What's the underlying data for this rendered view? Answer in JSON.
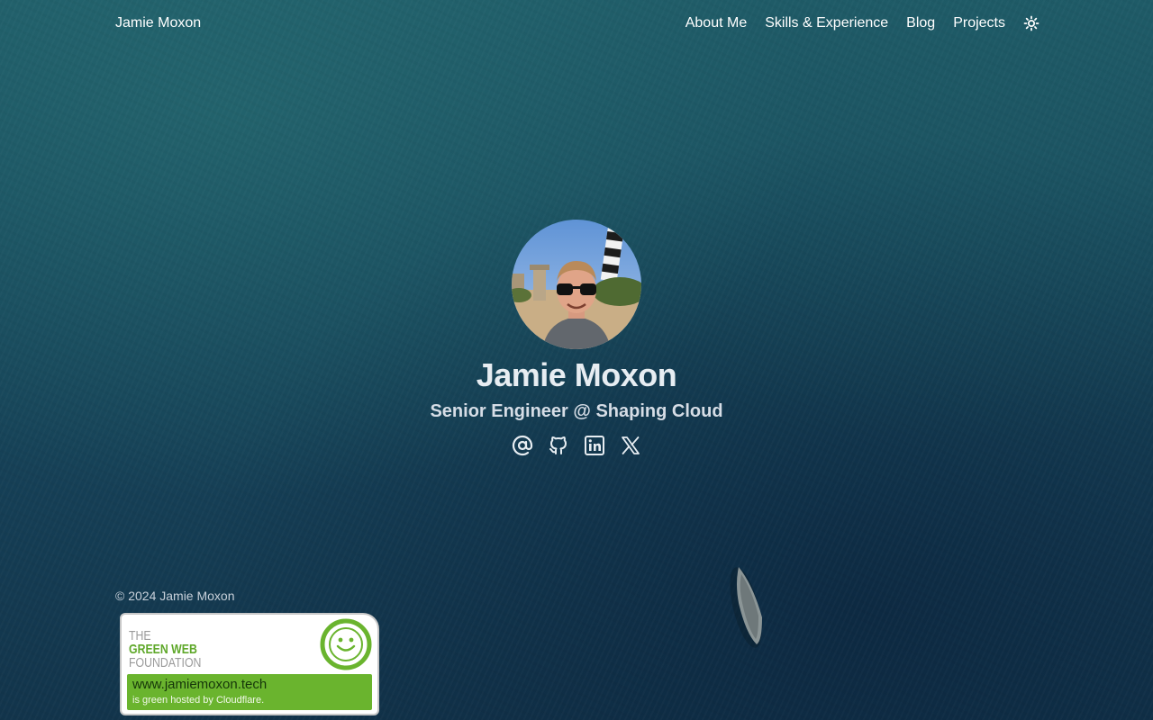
{
  "header": {
    "brand": "Jamie Moxon",
    "nav": [
      {
        "label": "About Me"
      },
      {
        "label": "Skills & Experience"
      },
      {
        "label": "Blog"
      },
      {
        "label": "Projects"
      }
    ],
    "theme_toggle_icon": "sun-icon"
  },
  "hero": {
    "avatar_icon": "profile-photo",
    "name": "Jamie Moxon",
    "subtitle": "Senior Engineer @ Shaping Cloud",
    "social": [
      {
        "icon": "at-sign-icon"
      },
      {
        "icon": "github-icon"
      },
      {
        "icon": "linkedin-icon"
      },
      {
        "icon": "x-twitter-icon"
      }
    ]
  },
  "footer": {
    "copyright": "© 2024 Jamie Moxon",
    "badge": {
      "logo_line1": "THE",
      "logo_line2": "GREEN WEB",
      "logo_line3": "FOUNDATION",
      "url": "www.jamiemoxon.tech",
      "note": "is green hosted by Cloudflare."
    }
  },
  "colors": {
    "background": "#194c5e",
    "text": "#ffffff",
    "heading": "#e7edf2",
    "badge_green": "#6ab42e"
  }
}
